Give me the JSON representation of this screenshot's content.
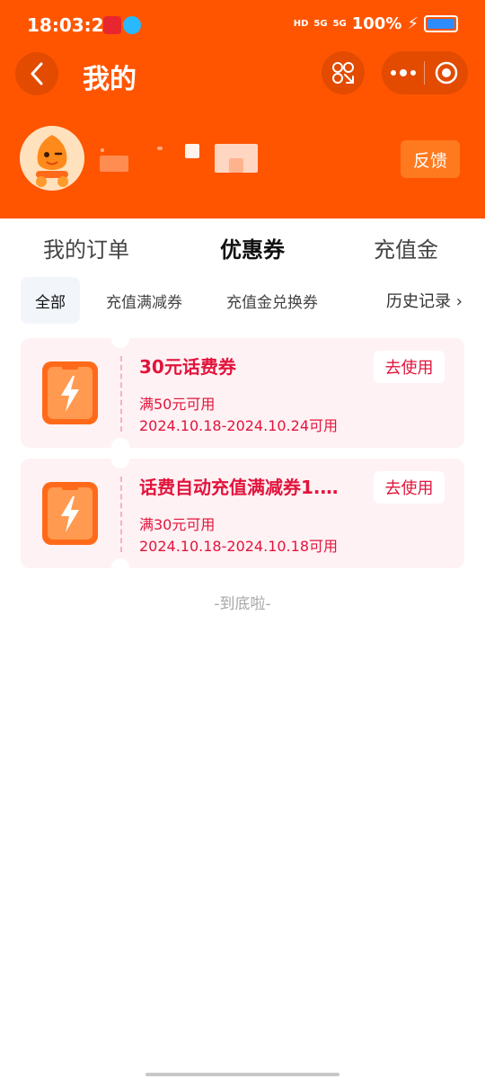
{
  "status_bar": {
    "time": "18:03:20",
    "hd_label": "HD",
    "net1": "5G",
    "net2": "5G",
    "battery_text": "100%"
  },
  "nav": {
    "title": "我的"
  },
  "profile": {
    "feedback_label": "反馈"
  },
  "tabs": [
    {
      "label": "我的订单",
      "active": false
    },
    {
      "label": "优惠券",
      "active": true
    },
    {
      "label": "充值金",
      "active": false
    }
  ],
  "filters": [
    {
      "label": "全部",
      "active": true
    },
    {
      "label": "充值满减券",
      "active": false
    },
    {
      "label": "充值金兑换券",
      "active": false
    }
  ],
  "history_label": "历史记录 ›",
  "coupons": [
    {
      "title": "30元话费券",
      "condition": "满50元可用",
      "validity": "2024.10.18-2024.10.24可用",
      "action": "去使用"
    },
    {
      "title": "话费自动充值满减券1.…",
      "condition": "满30元可用",
      "validity": "2024.10.18-2024.10.18可用",
      "action": "去使用"
    }
  ],
  "end_text": "-到底啦-",
  "colors": {
    "brand": "#ff5500",
    "coupon_red": "#e2143c",
    "card_bg": "#fff2f4"
  },
  "icons": [
    "back-icon",
    "scan-icon",
    "more-icon",
    "target-icon",
    "lightning-icon"
  ]
}
